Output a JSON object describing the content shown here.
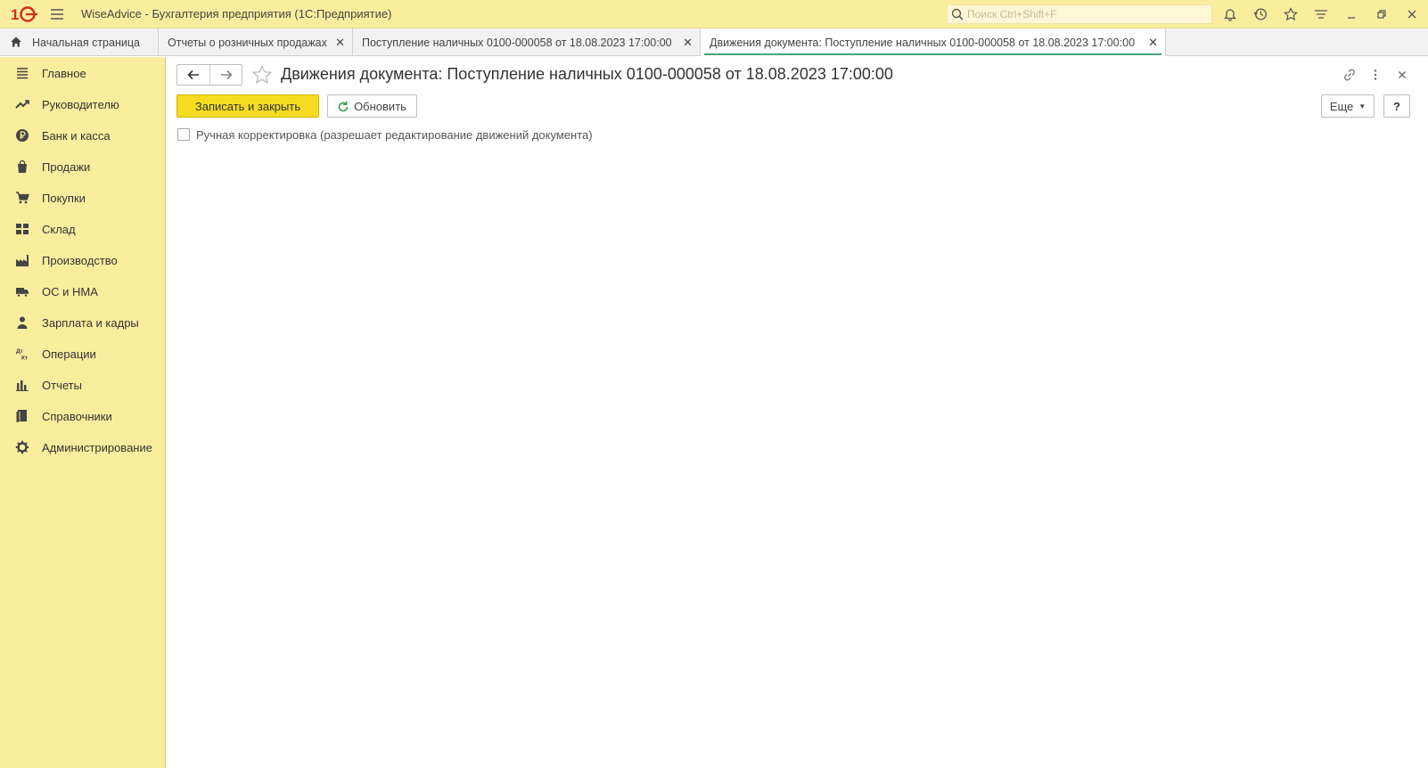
{
  "app": {
    "logo_text": "1С",
    "title": "WiseAdvice - Бухгалтерия предприятия  (1С:Предприятие)"
  },
  "search": {
    "placeholder": "Поиск Ctrl+Shift+F",
    "value": ""
  },
  "toolbar_icons": [
    "bell-icon",
    "history-icon",
    "star-icon",
    "filter-lines-icon",
    "minimize-icon",
    "restore-icon",
    "close-icon"
  ],
  "tabs": [
    {
      "label": "Начальная страница",
      "icon": "home-icon",
      "closable": false
    },
    {
      "label": "Отчеты о розничных продажах",
      "closable": true
    },
    {
      "label": "Поступление наличных 0100-000058 от 18.08.2023 17:00:00",
      "closable": true
    },
    {
      "label": "Движения документа: Поступление наличных 0100-000058 от 18.08.2023 17:00:00",
      "closable": true,
      "active": true
    }
  ],
  "sidebar": {
    "items": [
      {
        "label": "Главное",
        "icon": "menu-lines-icon"
      },
      {
        "label": "Руководителю",
        "icon": "trend-icon"
      },
      {
        "label": "Банк и касса",
        "icon": "ruble-icon"
      },
      {
        "label": "Продажи",
        "icon": "bag-icon"
      },
      {
        "label": "Покупки",
        "icon": "cart-icon"
      },
      {
        "label": "Склад",
        "icon": "warehouse-icon"
      },
      {
        "label": "Производство",
        "icon": "factory-icon"
      },
      {
        "label": "ОС и НМА",
        "icon": "truck-icon"
      },
      {
        "label": "Зарплата и кадры",
        "icon": "person-icon"
      },
      {
        "label": "Операции",
        "icon": "dt-kt-icon"
      },
      {
        "label": "Отчеты",
        "icon": "bar-chart-icon"
      },
      {
        "label": "Справочники",
        "icon": "books-icon"
      },
      {
        "label": "Администрирование",
        "icon": "gear-icon"
      }
    ]
  },
  "form": {
    "title": "Движения документа: Поступление наличных 0100-000058 от 18.08.2023 17:00:00",
    "save_close_label": "Записать и закрыть",
    "refresh_label": "Обновить",
    "more_label": "Еще",
    "help_label": "?",
    "manual_correction": {
      "label": "Ручная корректировка (разрешает редактирование движений документа)",
      "checked": false
    }
  },
  "colors": {
    "accent_yellow": "#fbed9e",
    "button_primary": "#f5dc22",
    "logo_red": "#d52b1e",
    "active_tab_underline": "#4aa37b"
  }
}
